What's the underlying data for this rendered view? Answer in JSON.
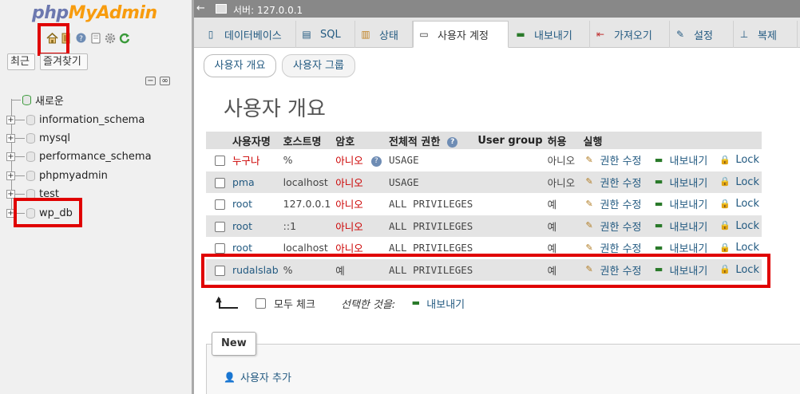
{
  "logo": {
    "php": "php",
    "myadmin": "MyAdmin"
  },
  "nav": {
    "recent_label": "최근",
    "favorites_label": "즐겨찾기",
    "tree": [
      {
        "name": "새로운"
      },
      {
        "name": "information_schema"
      },
      {
        "name": "mysql"
      },
      {
        "name": "performance_schema"
      },
      {
        "name": "phpmyadmin"
      },
      {
        "name": "test"
      },
      {
        "name": "wp_db"
      }
    ]
  },
  "topbar": {
    "server": "서버: 127.0.0.1"
  },
  "tabs": [
    {
      "label": "데이터베이스",
      "icon": "database-icon"
    },
    {
      "label": "SQL",
      "icon": "sql-icon"
    },
    {
      "label": "상태",
      "icon": "status-icon"
    },
    {
      "label": "사용자 계정",
      "icon": "user-accounts-icon"
    },
    {
      "label": "내보내기",
      "icon": "export-icon"
    },
    {
      "label": "가져오기",
      "icon": "import-icon"
    },
    {
      "label": "설정",
      "icon": "settings-icon"
    },
    {
      "label": "복제",
      "icon": "replication-icon"
    }
  ],
  "subtabs": [
    {
      "label": "사용자 개요"
    },
    {
      "label": "사용자 그룹"
    }
  ],
  "page_title": "사용자 개요",
  "table": {
    "headers": [
      "사용자명",
      "호스트명",
      "암호",
      "전체적 권한",
      "User group",
      "허용",
      "실행"
    ],
    "rows": [
      {
        "user": "누구나",
        "host": "%",
        "password": "아니오",
        "privileges": "USAGE",
        "group": "",
        "grant": "아니오",
        "edit": "권한 수정",
        "export": "내보내기",
        "lock": "Lock"
      },
      {
        "user": "pma",
        "host": "localhost",
        "password": "아니오",
        "privileges": "USAGE",
        "group": "",
        "grant": "아니오",
        "edit": "권한 수정",
        "export": "내보내기",
        "lock": "Lock"
      },
      {
        "user": "root",
        "host": "127.0.0.1",
        "password": "아니오",
        "privileges": "ALL PRIVILEGES",
        "group": "",
        "grant": "예",
        "edit": "권한 수정",
        "export": "내보내기",
        "lock": "Lock"
      },
      {
        "user": "root",
        "host": "::1",
        "password": "아니오",
        "privileges": "ALL PRIVILEGES",
        "group": "",
        "grant": "예",
        "edit": "권한 수정",
        "export": "내보내기",
        "lock": "Lock"
      },
      {
        "user": "root",
        "host": "localhost",
        "password": "아니오",
        "privileges": "ALL PRIVILEGES",
        "group": "",
        "grant": "예",
        "edit": "권한 수정",
        "export": "내보내기",
        "lock": "Lock"
      },
      {
        "user": "rudalslab",
        "host": "%",
        "password": "예",
        "privileges": "ALL PRIVILEGES",
        "group": "",
        "grant": "예",
        "edit": "권한 수정",
        "export": "내보내기",
        "lock": "Lock"
      }
    ]
  },
  "bulk": {
    "check_all": "모두 체크",
    "with_selected": "선택한 것을:",
    "export": "내보내기"
  },
  "new_section": {
    "legend": "New",
    "add_user": "사용자 추가"
  },
  "colors": {
    "highlight_red": "#e00000",
    "link_blue": "#235a81",
    "no_red": "#cc0000"
  }
}
